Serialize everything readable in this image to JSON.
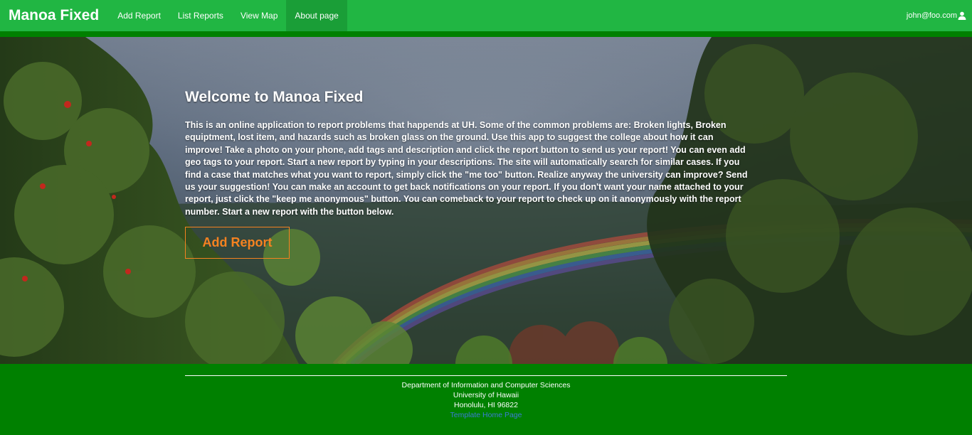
{
  "navbar": {
    "brand": "Manoa Fixed",
    "items": [
      {
        "label": "Add Report",
        "active": false
      },
      {
        "label": "List Reports",
        "active": false
      },
      {
        "label": "View Map",
        "active": false
      },
      {
        "label": "About page",
        "active": true
      }
    ],
    "user": {
      "email": "john@foo.com",
      "icon": "user-icon"
    }
  },
  "hero": {
    "title": "Welcome to Manoa Fixed",
    "description": "This is an online application to report problems that happends at UH. Some of the common problems are: Broken lights, Broken equiptment, lost item, and hazards such as broken glass on the ground. Use this app to suggest the college about how it can improve! Take a photo on your phone, add tags and description and click the report button to send us your report! You can even add geo tags to your report. Start a new report by typing in your descriptions. The site will automatically search for similar cases. If you find a case that matches what you want to report, simply click the \"me too\" button. Realize anyway the university can improve? Send us your suggestion! You can make an account to get back notifications on your report. If you don't want your name attached to your report, just click the \"keep me anonymous\" button. You can comeback to your report to check up on it anonymously with the report number. Start a new report with the button below.",
    "button_label": "Add Report"
  },
  "footer": {
    "line1": "Department of Information and Computer Sciences",
    "line2": "University of Hawaii",
    "line3": "Honolulu, HI 96822",
    "link": "Template Home Page"
  },
  "colors": {
    "nav_green": "#21b643",
    "nav_active": "#1a9e37",
    "footer_green": "#008000",
    "accent_orange": "#f58220",
    "link_blue": "#3b7bd6"
  }
}
